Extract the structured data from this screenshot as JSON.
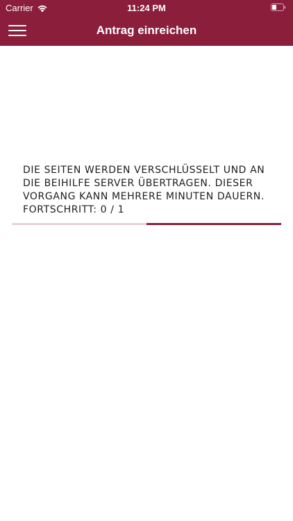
{
  "status_bar": {
    "carrier": "Carrier",
    "time": "11:24 PM",
    "battery_icon": "battery-icon",
    "wifi_icon": "wifi-icon"
  },
  "nav_bar": {
    "title": "Antrag einreichen",
    "menu_icon": "hamburger-menu-icon"
  },
  "upload": {
    "message_line1": "DIE SEITEN WERDEN VERSCHLÜSSELT UND AN",
    "message_line2": "DIE BEIHILFE SERVER ÜBERTRAGEN. DIESER",
    "message_line3": "VORGANG KANN MEHRERE MINUTEN DAUERN.",
    "progress_text": "FORTSCHRITT: 0 / 1",
    "progress_fraction": 0.5
  },
  "colors": {
    "brand": "#8b1e3a",
    "progress_track": "#ead0d8",
    "text": "#1d1d1d",
    "background": "#ffffff"
  }
}
